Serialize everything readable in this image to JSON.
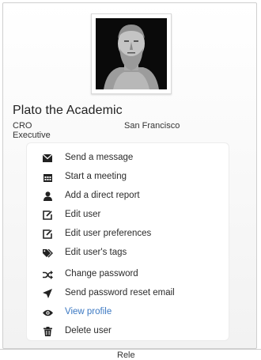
{
  "profile": {
    "name": "Plato the Academic",
    "title_line1": "CRO",
    "title_line2": "Executive",
    "location": "San Francisco",
    "photo_icon": "bust-portrait"
  },
  "menu": {
    "items": [
      {
        "label": "Send a message",
        "icon": "envelope-icon"
      },
      {
        "label": "Start a meeting",
        "icon": "calendar-icon"
      },
      {
        "label": "Add a direct report",
        "icon": "user-icon"
      },
      {
        "label": "Edit user",
        "icon": "edit-icon"
      },
      {
        "label": "Edit user preferences",
        "icon": "edit-icon"
      },
      {
        "label": "Edit user's tags",
        "icon": "tags-icon"
      },
      {
        "label": "Change password",
        "icon": "shuffle-icon"
      },
      {
        "label": "Send password reset email",
        "icon": "send-icon"
      },
      {
        "label": "View profile",
        "icon": "eye-icon"
      },
      {
        "label": "Delete user",
        "icon": "trash-icon"
      }
    ]
  },
  "colors": {
    "link": "#3b78c2",
    "text": "#2b2b2b",
    "icon": "#222222"
  },
  "footer": {
    "partial_text": "Rele"
  }
}
